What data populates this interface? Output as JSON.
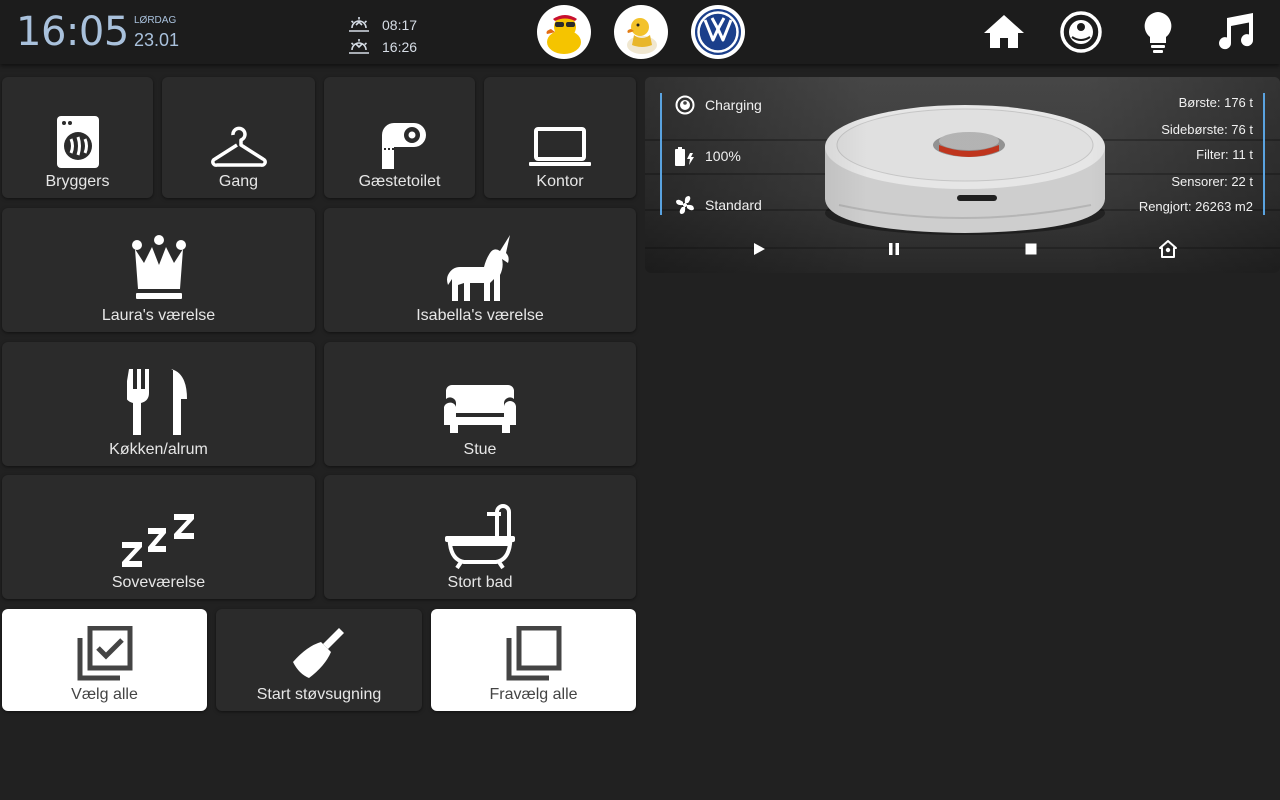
{
  "header": {
    "time": "16:05",
    "weekday": "LØRDAG",
    "date": "23.01",
    "sunrise": "08:17",
    "sunset": "16:26"
  },
  "avatars": [
    {
      "name": "duck-sunglasses-avatar"
    },
    {
      "name": "duck-sitting-avatar"
    },
    {
      "name": "volkswagen-logo-avatar"
    }
  ],
  "nav": [
    {
      "icon": "home-icon"
    },
    {
      "icon": "robot-vacuum-icon"
    },
    {
      "icon": "lightbulb-icon"
    },
    {
      "icon": "music-note-icon"
    }
  ],
  "rooms": {
    "bryggers": "Bryggers",
    "gang": "Gang",
    "gaestetoilet": "Gæstetoilet",
    "kontor": "Kontor",
    "laura": "Laura's værelse",
    "isabella": "Isabella's værelse",
    "kokken": "Køkken/alrum",
    "stue": "Stue",
    "sovevaerelse": "Soveværelse",
    "stortbad": "Stort bad"
  },
  "actions": {
    "select_all": "Vælg alle",
    "start": "Start støvsugning",
    "deselect_all": "Fravælg alle"
  },
  "vacuum": {
    "status": "Charging",
    "battery": "100%",
    "fan_speed": "Standard",
    "brush": "Børste: 176 t",
    "side_brush": "Sidebørste: 76 t",
    "filter": "Filter: 11 t",
    "sensors": "Sensorer: 22 t",
    "cleaned": "Rengjort: 26263 m2",
    "accent": "#5aa3e0"
  },
  "colors": {
    "background": "#212121",
    "tile": "#2b2b2b",
    "tile_selected": "#ffffff",
    "clock": "#a9c1dc"
  }
}
